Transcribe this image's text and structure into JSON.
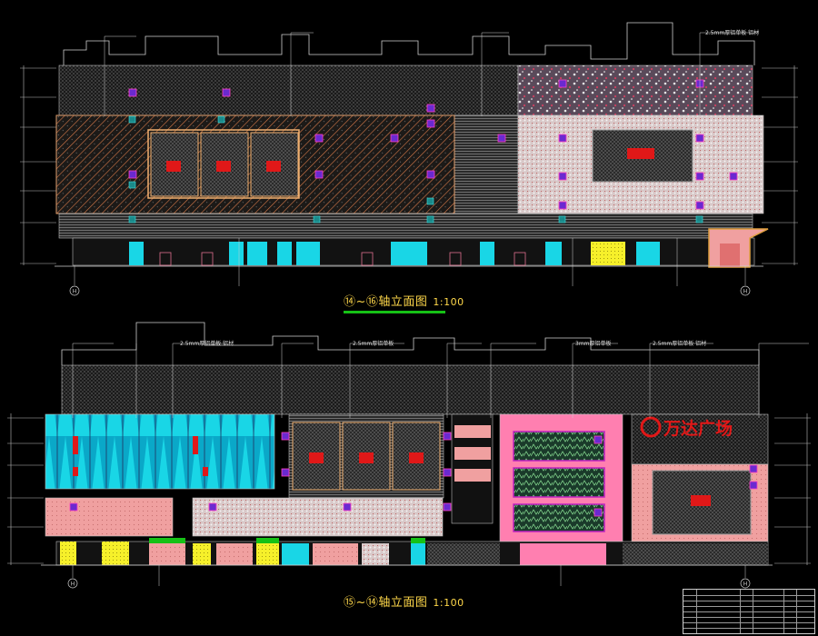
{
  "drawings": [
    {
      "title": "⑭~⑯轴立面图",
      "scale": "1:100",
      "axis_left": "H",
      "axis_right": "H",
      "annotations": [
        "2.5mm厚铝单板 铝材"
      ]
    },
    {
      "title": "⑮~⑭轴立面图",
      "scale": "1:100",
      "axis_left": "H",
      "axis_right": "H",
      "annotations": [
        "2.5mm厚铝单板 铝材",
        "2.5mm厚铝单板",
        "3mm厚铝单板",
        "2.5mm厚铝单板 铝材"
      ],
      "sign_text": "万达广场"
    }
  ],
  "colors": {
    "background": "#000000",
    "hatch_grey": "#8a8a8a",
    "salmon": "#f2a0a0",
    "cyan": "#19d6e6",
    "pink": "#ff7fb0",
    "yellow": "#f6f02a",
    "red": "#e01818",
    "magenta": "#c020c0",
    "orange": "#e0a040",
    "green_underline": "#16c116",
    "title_text": "#ffd84a"
  }
}
